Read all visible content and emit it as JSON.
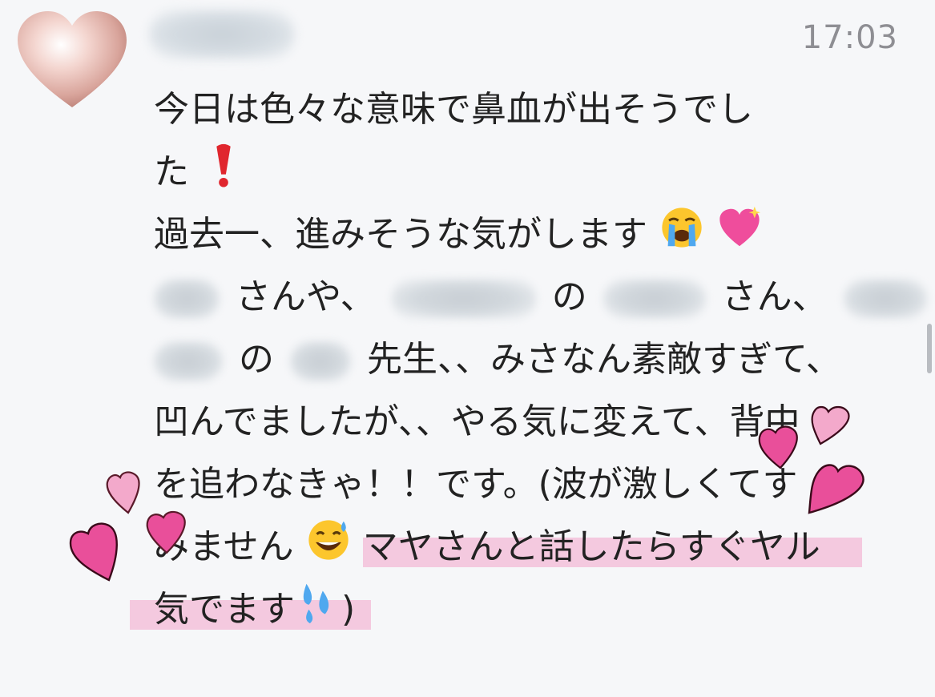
{
  "header": {
    "timestamp": "17:03"
  },
  "message": {
    "line1": "今日は色々な意味で鼻血が出そうでし",
    "line2": "た",
    "line3": "過去一、進みそうな気がします",
    "line4a": "さんや、",
    "line4b": "の",
    "line4c": "さん、",
    "line5a": "の",
    "line5b": "先生、、みさなん素敵すぎて、",
    "line6": "凹んでましたが、、やる気に変えて、背中",
    "line7": "を追わなきゃ！！です。(波が激しくてす",
    "line8a": "みません",
    "line8b": "マヤさんと話したらすぐヤル",
    "line9a": "気でます",
    "line9b": ")"
  },
  "icons": {
    "avatar": "heart-avatar-icon",
    "exclamation": "red-exclamation-icon",
    "crying": "crying-face-icon",
    "sparkle_heart": "sparkling-heart-icon",
    "sweat_smile": "sweat-smile-icon",
    "droplets": "sweat-droplets-icon"
  },
  "colors": {
    "background": "#f6f7f9",
    "highlight": "#f4c9df",
    "heart_pink": "#e94f9a",
    "heart_light": "#f3a9cb",
    "timestamp": "#8e8e93"
  }
}
